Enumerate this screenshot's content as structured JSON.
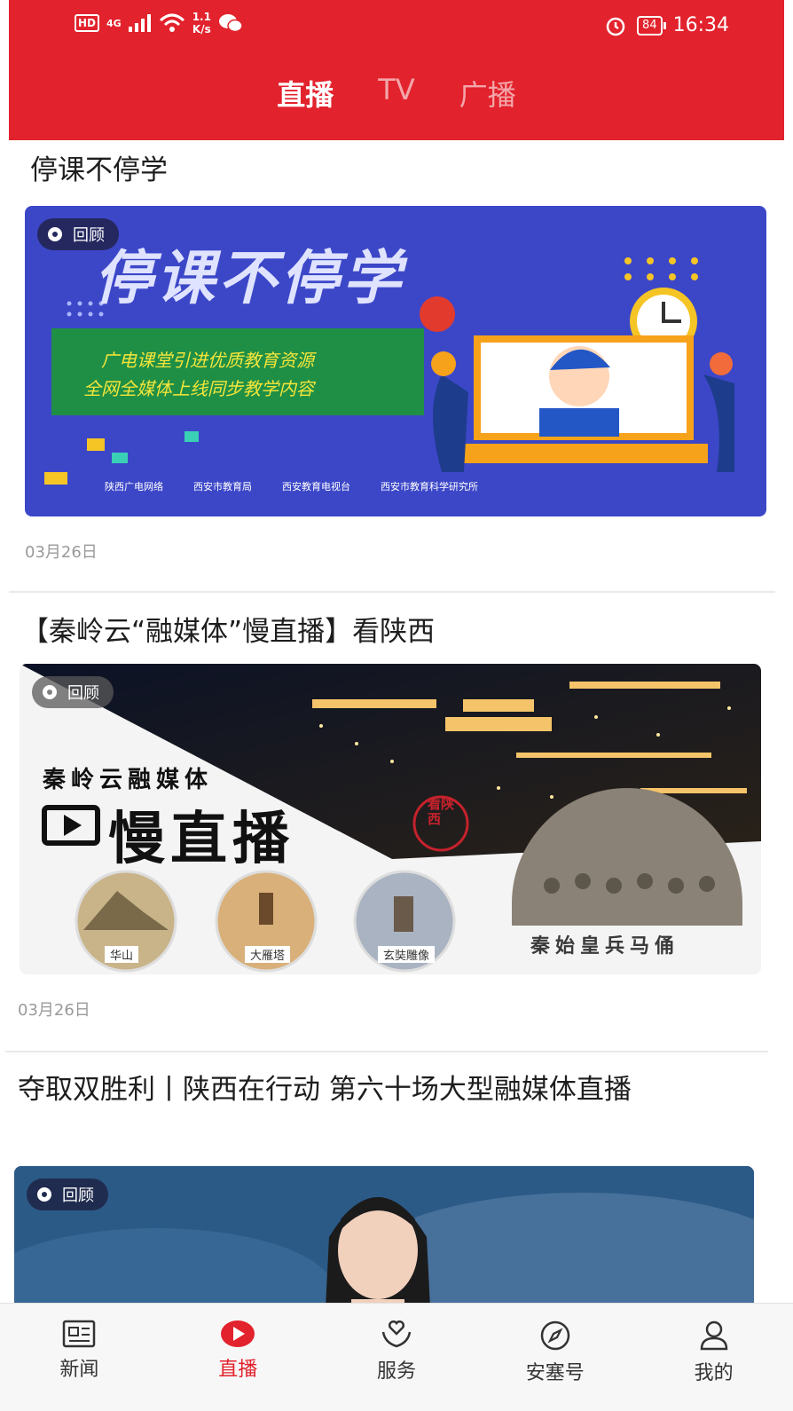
{
  "status_bar": {
    "network_badge": "HD",
    "signal": "4G",
    "speed_value": "1.1",
    "speed_unit": "K/s",
    "battery": "84",
    "time": "16:34"
  },
  "tabs": [
    {
      "label": "直播",
      "active": true
    },
    {
      "label": "TV",
      "active": false
    },
    {
      "label": "广播",
      "active": false
    }
  ],
  "feed": [
    {
      "title": "停课不停学",
      "badge": "回顾",
      "date": "03月26日",
      "poster": {
        "headline": "停课不停学",
        "line1": "广电课堂引进优质教育资源",
        "line2": "全网全媒体上线同步教学内容",
        "logos": [
          "陕西广电网络",
          "西安市教育局",
          "西安教育电视台",
          "西安市教育科学研究所"
        ]
      }
    },
    {
      "title": "【秦岭云“融媒体”慢直播】看陕西",
      "badge": "回顾",
      "date": "03月26日",
      "poster": {
        "brand": "秦岭云融媒体",
        "headline": "慢直播",
        "seal": "看陕西",
        "spots": [
          "华山",
          "大雁塔",
          "玄奘雕像"
        ],
        "feature": "秦始皇兵马俑"
      }
    },
    {
      "title": "夺取双胜利丨陕西在行动 第六十场大型融媒体直播",
      "badge": "回顾"
    }
  ],
  "bottom_nav": [
    {
      "label": "新闻",
      "icon": "newspaper-icon",
      "active": false
    },
    {
      "label": "直播",
      "icon": "play-icon",
      "active": true
    },
    {
      "label": "服务",
      "icon": "heart-hand-icon",
      "active": false
    },
    {
      "label": "安塞号",
      "icon": "compass-icon",
      "active": false
    },
    {
      "label": "我的",
      "icon": "user-icon",
      "active": false
    }
  ],
  "colors": {
    "brand_red": "#e2222c",
    "poster_blue": "#3c47c8"
  }
}
